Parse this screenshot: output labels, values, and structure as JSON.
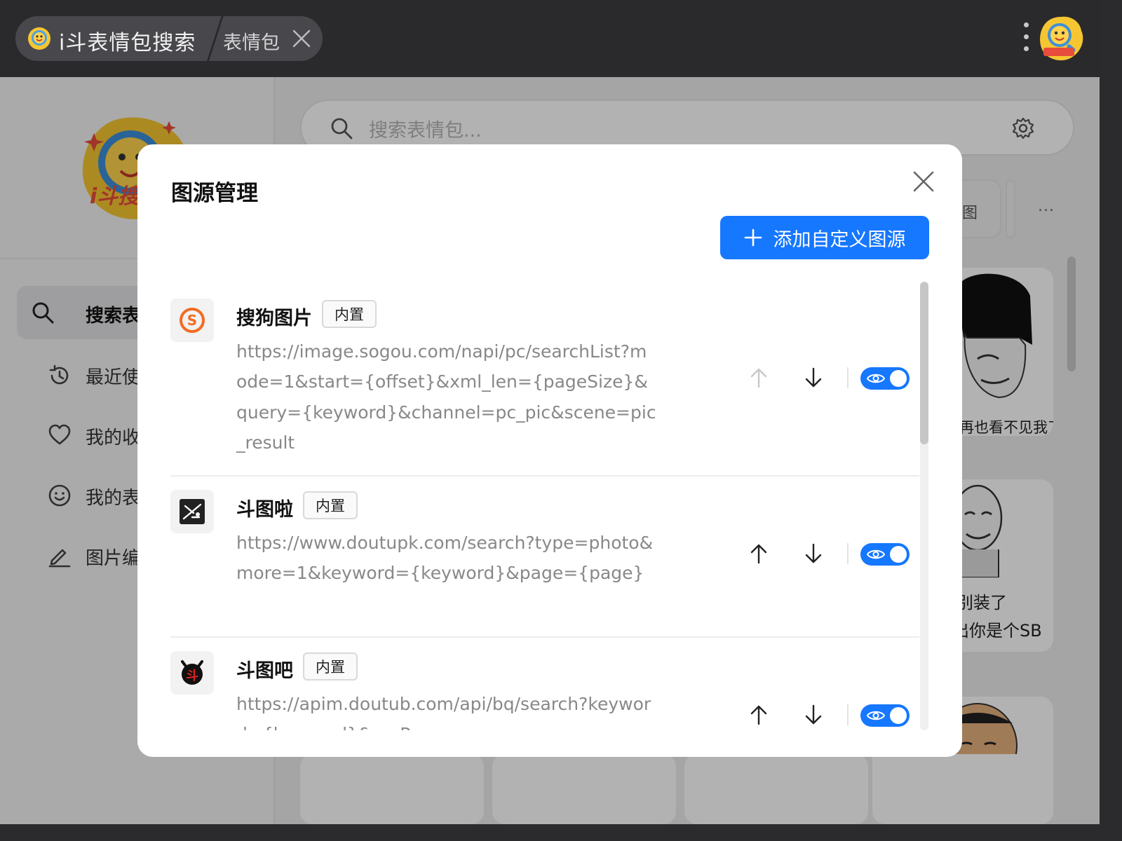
{
  "window": {
    "active_tab_title": "i斗表情包搜索",
    "second_tab_label": "表情包"
  },
  "sidebar": {
    "logo_text": "i斗搜图",
    "items": [
      {
        "label": "搜索表情包",
        "icon": "search-icon",
        "active": true
      },
      {
        "label": "最近使用",
        "icon": "history-icon",
        "active": false
      },
      {
        "label": "我的收藏",
        "icon": "heart-icon",
        "active": false
      },
      {
        "label": "我的表情",
        "icon": "smiley-icon",
        "active": false
      },
      {
        "label": "图片编辑",
        "icon": "pencil-icon",
        "active": false
      }
    ]
  },
  "search": {
    "placeholder": "搜索表情包..."
  },
  "background": {
    "chip_partial_label": "图",
    "more_label": "...",
    "card_captions": [
      "再也看不见我了",
      "别装了",
      "出你是个SB"
    ]
  },
  "dialog": {
    "title": "图源管理",
    "add_button_label": "添加自定义图源",
    "sources": [
      {
        "name": "搜狗图片",
        "tag": "内置",
        "url": "https://image.sogou.com/napi/pc/searchList?mode=1&start={offset}&xml_len={pageSize}&query={keyword}&channel=pc_pic&scene=pic_result",
        "move_up_enabled": false,
        "move_down_enabled": true,
        "visible": true
      },
      {
        "name": "斗图啦",
        "tag": "内置",
        "url": "https://www.doutupk.com/search?type=photo&more=1&keyword={keyword}&page={page}",
        "move_up_enabled": true,
        "move_down_enabled": true,
        "visible": true
      },
      {
        "name": "斗图吧",
        "tag": "内置",
        "url": "https://apim.doutub.com/api/bq/search?keyword={keyword}&curPage",
        "move_up_enabled": true,
        "move_down_enabled": true,
        "visible": true
      }
    ]
  },
  "colors": {
    "accent": "#1677ff",
    "titlebar": "#2a2a2c",
    "muted_text": "#888888"
  }
}
